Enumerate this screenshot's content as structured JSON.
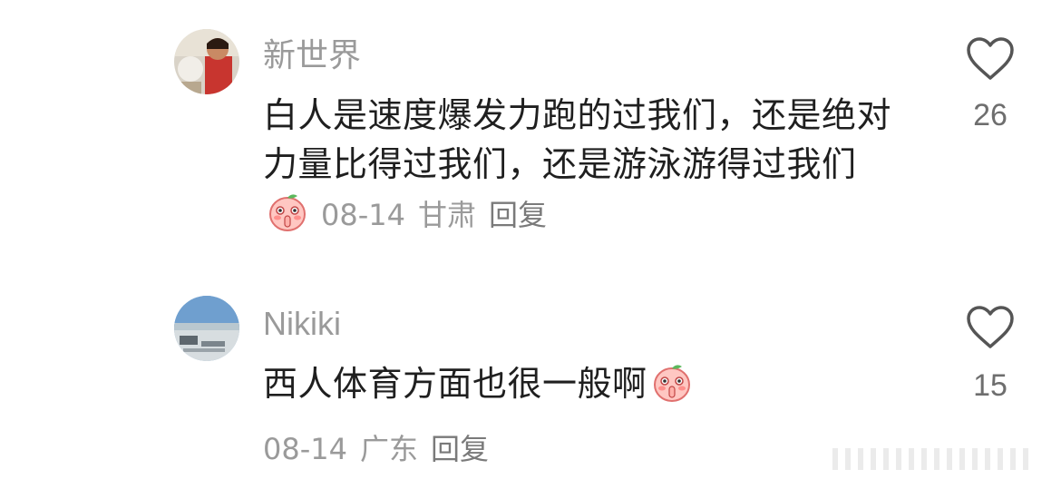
{
  "comments": [
    {
      "username": "新世界",
      "text_before_emoji": "白人是速度爆发力跑的过我们，还是绝对力量比得过我们，还是游泳游得过我们",
      "date": "08-14",
      "location": "甘肃",
      "reply_label": "回复",
      "like_count": "26"
    },
    {
      "username": "Nikiki",
      "text_before_emoji": "西人体育方面也很一般啊",
      "date": "08-14",
      "location": "广东",
      "reply_label": "回复",
      "like_count": "15"
    }
  ],
  "icons": {
    "like": "heart-outline-icon",
    "emoji": "peach-face-shushing-emoji"
  },
  "colors": {
    "username": "#9a9a9a",
    "body": "#1f1f1f",
    "meta": "#9a9a9a",
    "like": "#6e6e6e"
  }
}
